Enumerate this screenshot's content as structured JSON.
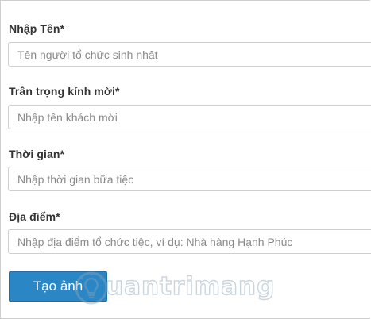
{
  "form": {
    "fields": [
      {
        "label": "Nhập Tên*",
        "placeholder": "Tên người tổ chức sinh nhật",
        "value": ""
      },
      {
        "label": "Trân trọng kính mời*",
        "placeholder": "Nhập tên khách mời",
        "value": ""
      },
      {
        "label": "Thời gian*",
        "placeholder": "Nhập thời gian bữa tiệc",
        "value": ""
      },
      {
        "label": "Địa điểm*",
        "placeholder": "Nhập địa điểm tổ chức tiệc, ví dụ: Nhà hàng Hạnh Phúc",
        "value": ""
      }
    ],
    "submit_label": "Tạo ảnh"
  },
  "watermark": {
    "text": "uantrimang",
    "icon": "lightbulb-icon"
  },
  "colors": {
    "button_bg": "#2a86c4",
    "button_text": "#ffffff",
    "label_text": "#333333",
    "field_border": "#cfcfcf",
    "placeholder_text": "#8a8a8a"
  }
}
